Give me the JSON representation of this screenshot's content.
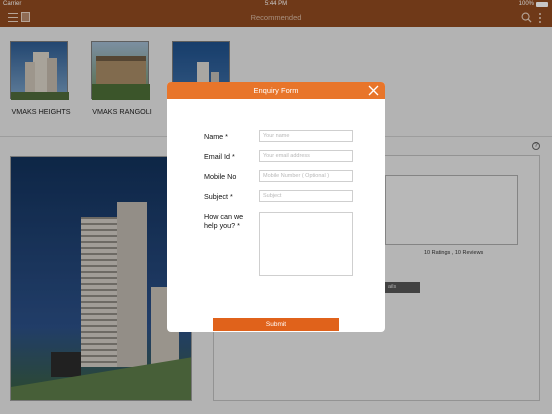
{
  "status_bar": {
    "carrier": "Carrier",
    "time": "5:44 PM",
    "battery": "100%"
  },
  "nav": {
    "title": "Recommended"
  },
  "projects": [
    {
      "name": "VMAKS HEIGHTS"
    },
    {
      "name": "VMAKS RANGOLI"
    },
    {
      "name": ""
    }
  ],
  "details": {
    "ratings_text": "10 Ratings , 10 Reviews",
    "button_partial": "ails",
    "chart_partial": "b"
  },
  "modal": {
    "title": "Enquiry Form",
    "fields": {
      "name": {
        "label": "Name *",
        "placeholder": "Your name",
        "value": ""
      },
      "email": {
        "label": "Email Id *",
        "placeholder": "Your email address",
        "value": ""
      },
      "mobile": {
        "label": "Mobile No",
        "placeholder": "Mobile Number ( Optional )",
        "value": ""
      },
      "subject": {
        "label": "Subject *",
        "placeholder": "Subject",
        "value": ""
      },
      "help": {
        "label": "How can we help you? *",
        "value": ""
      }
    },
    "submit_label": "Submit"
  },
  "colors": {
    "nav_bg": "#8f4a1f",
    "accent": "#e8752a",
    "submit": "#e0621b"
  }
}
